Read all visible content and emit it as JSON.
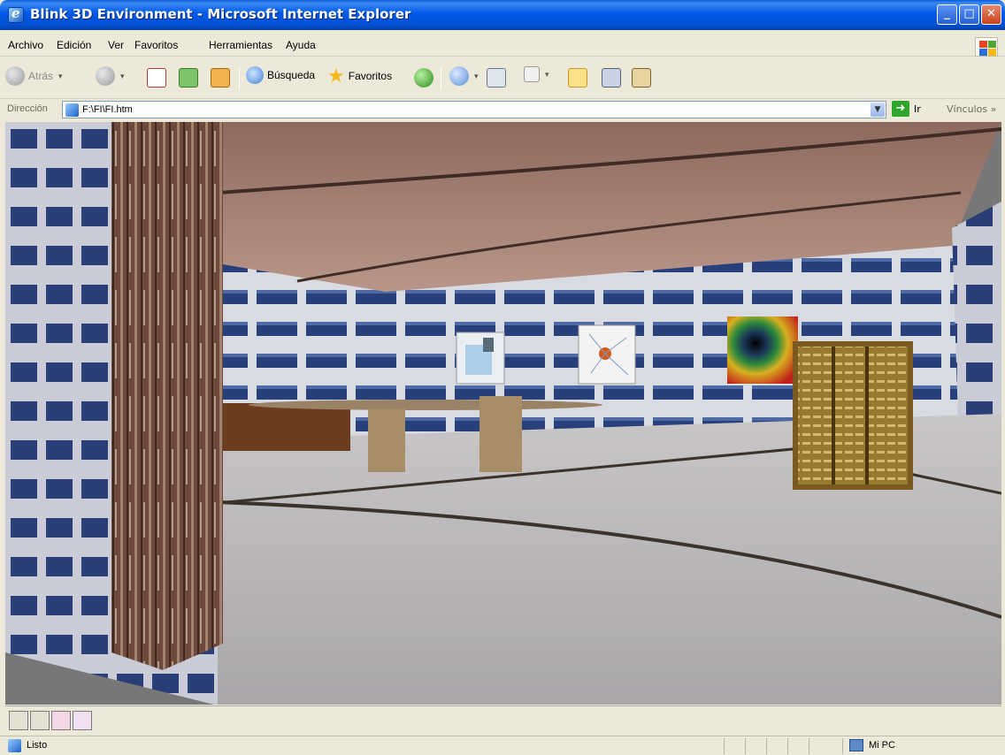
{
  "window": {
    "title": "Blink 3D Environment - Microsoft Internet Explorer"
  },
  "menu": {
    "items": [
      "Archivo",
      "Edición",
      "Ver",
      "Favoritos",
      "Herramientas",
      "Ayuda"
    ]
  },
  "toolbar": {
    "back_label": "Atrás",
    "search_label": "Búsqueda",
    "favorites_label": "Favoritos"
  },
  "address": {
    "label": "Dirección",
    "url": "F:\\FI\\FI.htm",
    "go_label": "Ir",
    "links_label": "Vínculos"
  },
  "status": {
    "text": "Listo",
    "zone": "Mi PC"
  },
  "scene": {
    "icons": [
      "pillar",
      "conference-table",
      "poster-water-tank",
      "poster-network",
      "poster-fractal",
      "bookshelf"
    ]
  }
}
